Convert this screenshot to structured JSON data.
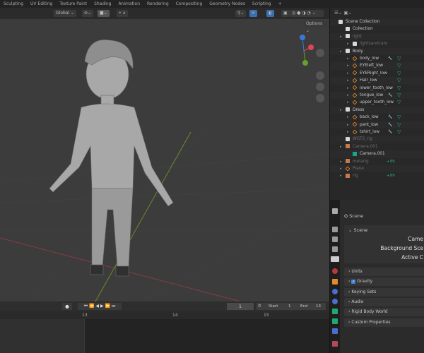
{
  "workspaces": [
    "Sculpting",
    "UV Editing",
    "Texture Paint",
    "Shading",
    "Animation",
    "Rendering",
    "Compositing",
    "Geometry Nodes",
    "Scripting",
    "+"
  ],
  "viewport": {
    "orientation": "Global",
    "options": "Options"
  },
  "outliner": {
    "rows": [
      {
        "label": "Scene Collection",
        "indent": 0,
        "icon": "collection",
        "dim": false
      },
      {
        "label": "Collection",
        "indent": 1,
        "icon": "collection",
        "dim": false
      },
      {
        "label": "light",
        "indent": 1,
        "icon": "collection",
        "dim": true
      },
      {
        "label": "lightsandcam",
        "indent": 2,
        "icon": "collection",
        "dim": true
      },
      {
        "label": "Body",
        "indent": 1,
        "icon": "collection",
        "dim": false
      },
      {
        "label": "body_low",
        "indent": 2,
        "icon": "mesh",
        "dim": false
      },
      {
        "label": "EYEleft_low",
        "indent": 2,
        "icon": "mesh",
        "dim": false
      },
      {
        "label": "EYERight_low",
        "indent": 2,
        "icon": "mesh",
        "dim": false
      },
      {
        "label": "Hair_low",
        "indent": 2,
        "icon": "mesh",
        "dim": false
      },
      {
        "label": "lower_tooth_low",
        "indent": 2,
        "icon": "mesh",
        "dim": false
      },
      {
        "label": "tongue_low",
        "indent": 2,
        "icon": "mesh",
        "dim": false
      },
      {
        "label": "upper_tooth_low",
        "indent": 2,
        "icon": "mesh",
        "dim": false
      },
      {
        "label": "Dress",
        "indent": 1,
        "icon": "collection",
        "dim": false
      },
      {
        "label": "back_low",
        "indent": 2,
        "icon": "mesh",
        "dim": false
      },
      {
        "label": "pant_low",
        "indent": 2,
        "icon": "mesh",
        "dim": false
      },
      {
        "label": "tshirt_low",
        "indent": 2,
        "icon": "mesh",
        "dim": false
      },
      {
        "label": "WGTS_rig",
        "indent": 1,
        "icon": "collection",
        "dim": true
      },
      {
        "label": "Camera.001",
        "indent": 1,
        "icon": "camera",
        "dim": true
      },
      {
        "label": "Camera.001",
        "indent": 2,
        "icon": "camera-data",
        "dim": false
      },
      {
        "label": "metarig",
        "indent": 1,
        "icon": "armature",
        "dim": true
      },
      {
        "label": "Plane",
        "indent": 1,
        "icon": "mesh",
        "dim": true
      },
      {
        "label": "rig",
        "indent": 1,
        "icon": "armature",
        "dim": true
      }
    ],
    "badge": "+99"
  },
  "properties": {
    "header": "Scene",
    "panel": "Scene",
    "fields": [
      "Came",
      "Background Sce",
      "Active C"
    ],
    "subpanels": [
      "Units",
      "Gravity",
      "Keying Sets",
      "Audio",
      "Rigid Body World",
      "Custom Properties"
    ],
    "gravity_checked": true
  },
  "timeline": {
    "current_frame": "1",
    "start_label": "Start",
    "start": "1",
    "end_label": "End",
    "end": "13",
    "ticks": [
      "13",
      "14",
      "15"
    ]
  }
}
